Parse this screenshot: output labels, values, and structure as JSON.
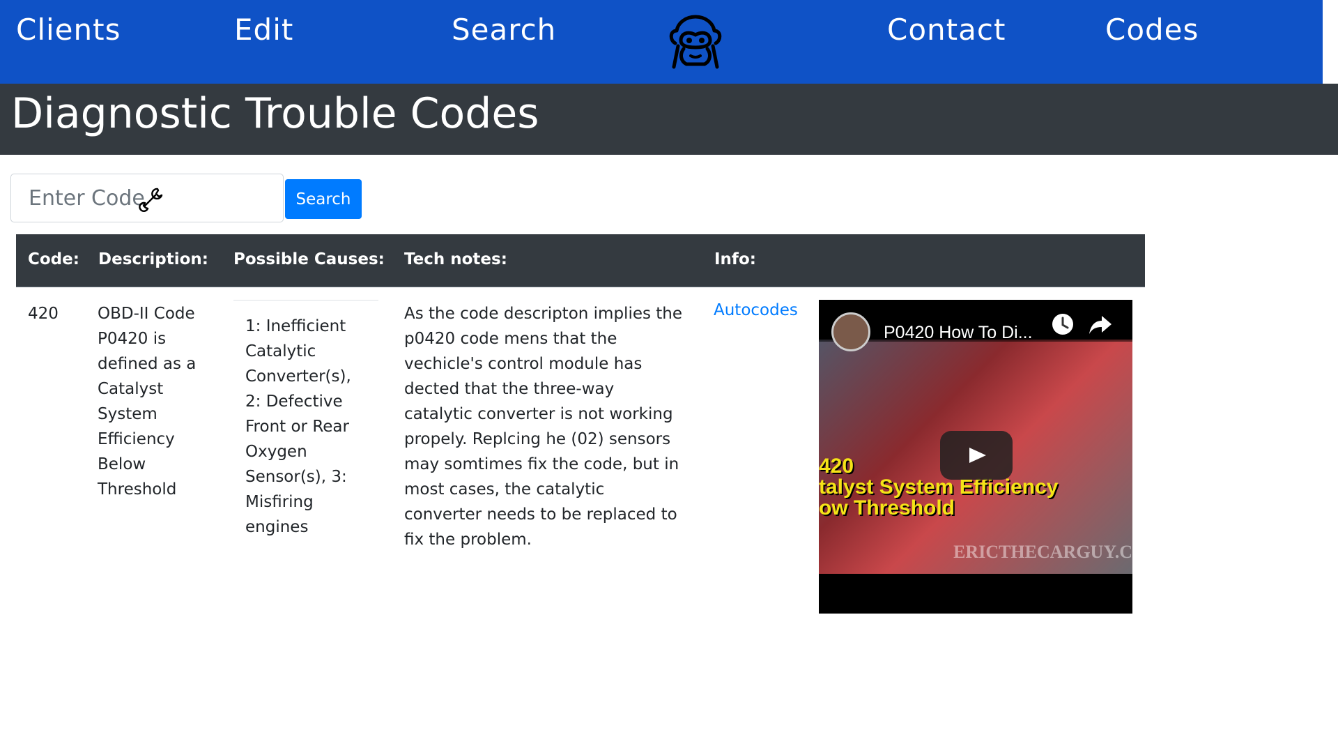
{
  "nav": {
    "items": [
      "Clients",
      "Edit",
      "Search",
      "Contact",
      "Codes"
    ],
    "logo_icon": "monkey-face-icon"
  },
  "page": {
    "title": "Diagnostic Trouble Codes"
  },
  "search": {
    "placeholder": "Enter Code",
    "value": "",
    "button_label": "Search",
    "icon": "wrench-icon"
  },
  "table": {
    "headers": [
      "Code:",
      "Description:",
      "Possible Causes:",
      "Tech notes:",
      "Info:"
    ],
    "rows": [
      {
        "code": "420",
        "description": "OBD-II Code P0420 is defined as a Catalyst System Efficiency Below Threshold",
        "causes": "1: Inefficient Catalytic Converter(s), 2: Defective Front or Rear Oxygen Sensor(s), 3: Misfiring engines",
        "tech_notes": "As the code descripton implies the p0420 code mens that the vechicle's control module has dected that the three-way catalytic converter is not working propely. Replcing he (02) sensors may somtimes fix the code, but in most cases, the catalytic converter needs to be replaced to fix the problem.",
        "info_link": "Autocodes",
        "video": {
          "title": "P0420 How To Di...",
          "overlay_lines": [
            "420",
            "talyst System Efficiency",
            "ow Threshold"
          ],
          "watermark": "ERICTHECARGUY.C"
        }
      }
    ]
  },
  "colors": {
    "nav_bg": "#0f52c6",
    "title_bg": "#343a40",
    "primary": "#007bff",
    "link": "#007bff",
    "overlay_text": "#f5e317"
  }
}
